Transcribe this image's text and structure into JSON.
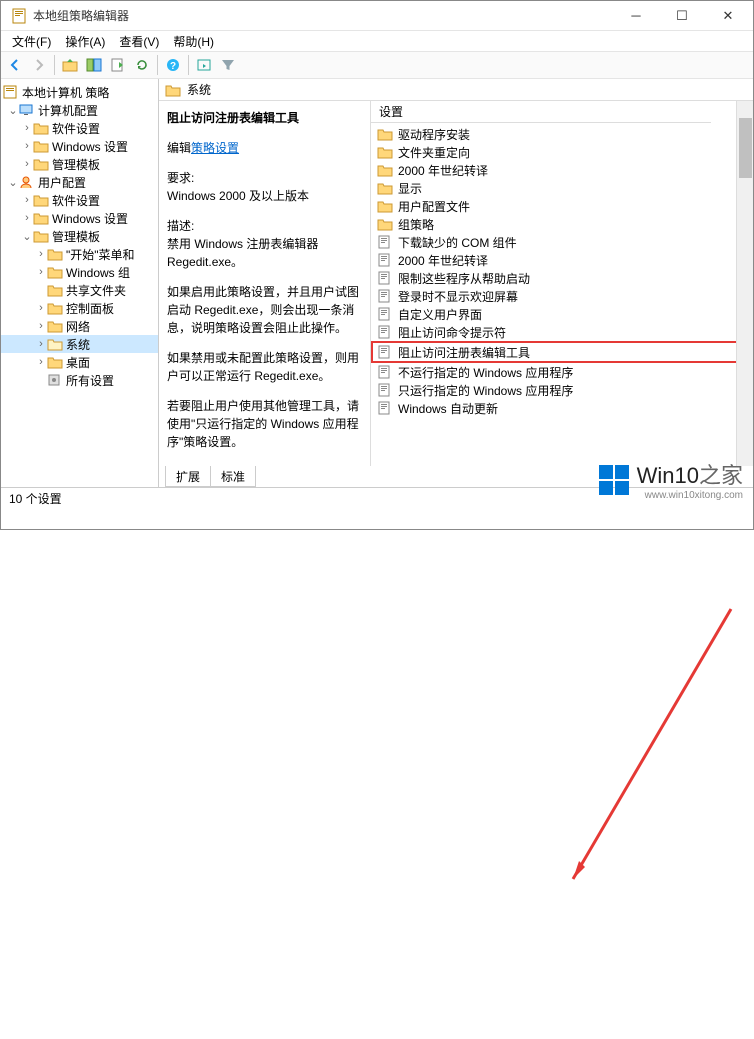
{
  "title": "本地组策略编辑器",
  "menus": [
    "文件(F)",
    "操作(A)",
    "查看(V)",
    "帮助(H)"
  ],
  "tree": {
    "root": "本地计算机 策略",
    "cc": "计算机配置",
    "cc_items": [
      "软件设置",
      "Windows 设置",
      "管理模板"
    ],
    "uc": "用户配置",
    "uc_items": [
      "软件设置",
      "Windows 设置"
    ],
    "adm": "管理模板",
    "adm_items": [
      "\"开始\"菜单和",
      "Windows 组",
      "共享文件夹",
      "控制面板",
      "网络",
      "系统",
      "桌面",
      "所有设置"
    ]
  },
  "header": "系统",
  "desc": {
    "title": "阻止访问注册表编辑工具",
    "edit": "编辑",
    "link": "策略设置",
    "req_lbl": "要求:",
    "req": "Windows 2000 及以上版本",
    "d_lbl": "描述:",
    "d": "禁用 Windows 注册表编辑器 Regedit.exe。",
    "p1": "如果启用此策略设置，并且用户试图启动 Regedit.exe，则会出现一条消息，说明策略设置会阻止此操作。",
    "p2": "如果禁用或未配置此策略设置，则用户可以正常运行 Regedit.exe。",
    "p3": "若要阻止用户使用其他管理工具，请使用\"只运行指定的 Windows 应用程序\"策略设置。"
  },
  "col": "设置",
  "items_folder": [
    "驱动程序安装",
    "文件夹重定向",
    "2000 年世纪转译",
    "显示",
    "用户配置文件",
    "组策略"
  ],
  "items_policy": [
    "下载缺少的 COM 组件",
    "2000 年世纪转译",
    "限制这些程序从帮助启动",
    "登录时不显示欢迎屏幕",
    "自定义用户界面",
    "阻止访问命令提示符",
    "阻止访问注册表编辑工具",
    "不运行指定的 Windows 应用程序",
    "只运行指定的 Windows 应用程序",
    "Windows 自动更新"
  ],
  "highlight_index": 6,
  "tabs": [
    "扩展",
    "标准"
  ],
  "status": "10 个设置",
  "wm": {
    "brand": "Win10",
    "suffix": "之家",
    "url": "www.win10xitong.com"
  }
}
